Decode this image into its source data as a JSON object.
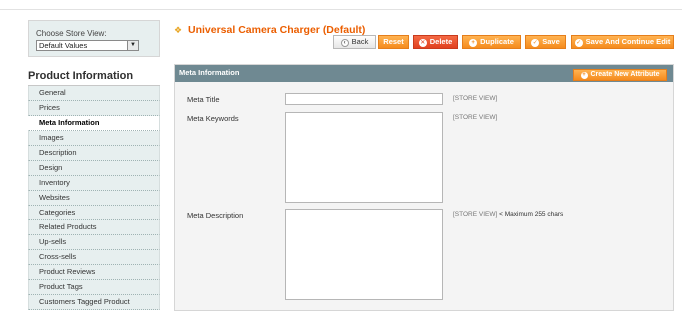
{
  "store": {
    "label": "Choose Store View:",
    "selected": "Default Values"
  },
  "sidebar": {
    "title": "Product Information",
    "items": [
      {
        "label": "General"
      },
      {
        "label": "Prices"
      },
      {
        "label": "Meta Information"
      },
      {
        "label": "Images"
      },
      {
        "label": "Description"
      },
      {
        "label": "Design"
      },
      {
        "label": "Inventory"
      },
      {
        "label": "Websites"
      },
      {
        "label": "Categories"
      },
      {
        "label": "Related Products"
      },
      {
        "label": "Up-sells"
      },
      {
        "label": "Cross-sells"
      },
      {
        "label": "Product Reviews"
      },
      {
        "label": "Product Tags"
      },
      {
        "label": "Customers Tagged Product"
      }
    ]
  },
  "header": {
    "title": "Universal Camera Charger (Default)",
    "buttons": {
      "back": "Back",
      "reset": "Reset",
      "delete": "Delete",
      "duplicate": "Duplicate",
      "save": "Save",
      "save_continue": "Save And Continue Edit"
    }
  },
  "section": {
    "title": "Meta Information",
    "create_attribute": "Create New Attribute",
    "fields": [
      {
        "label": "Meta Title",
        "value": "",
        "scope": "[STORE VIEW]",
        "note": ""
      },
      {
        "label": "Meta Keywords",
        "value": "",
        "scope": "[STORE VIEW]",
        "note": ""
      },
      {
        "label": "Meta Description",
        "value": "",
        "scope": "[STORE VIEW]",
        "note": "< Maximum 255 chars"
      }
    ]
  },
  "colors": {
    "accent": "#eb5e00",
    "button": "#f58b1d",
    "section_header": "#6f8992",
    "sidebar_bg": "#e7efef"
  },
  "icons": {
    "title": "product-box-icon",
    "back": "back-arrow-icon",
    "delete": "delete-x-icon",
    "duplicate": "plus-icon",
    "save": "check-icon",
    "save_continue": "check-icon",
    "create_attribute": "plus-icon"
  }
}
